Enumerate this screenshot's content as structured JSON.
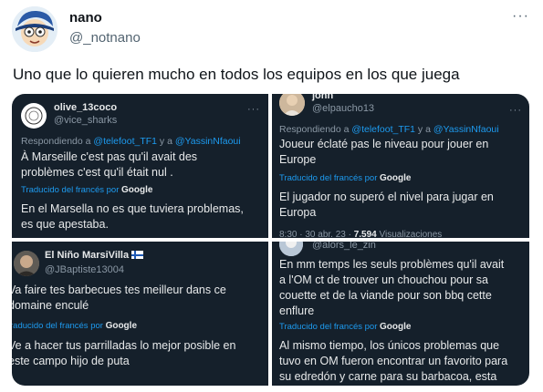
{
  "author": {
    "name": "nano",
    "handle": "@_notnano",
    "more_icon": "more-dots-icon"
  },
  "tweet": {
    "text": "Uno que lo quieren mucho en todos los equipos en los que juega"
  },
  "panels": [
    {
      "name": "olive_13coco",
      "handle": "@vice_sharks",
      "reply_prefix": "Respondiendo a ",
      "mention1": "@telefoot_TF1",
      "reply_and": " y a ",
      "mention2": "@YassinNfaoui",
      "original_lines": [
        "À  Marseille c'est pas qu'il avait des",
        "problèmes c'est qu'il était nul ."
      ],
      "translated_by": "Traducido del francés por ",
      "google": "Google",
      "translation_lines": [
        "En el Marsella no es que tuviera problemas,",
        "es que apestaba."
      ]
    },
    {
      "name": "john",
      "handle": "@elpaucho13",
      "reply_prefix": "Respondiendo a ",
      "mention1": "@telefoot_TF1",
      "reply_and": " y a ",
      "mention2": "@YassinNfaoui",
      "original_lines": [
        "Joueur éclaté pas le niveau pour jouer en",
        "Europe"
      ],
      "translated_by": "Traducido del francés por ",
      "google": "Google",
      "translation_lines": [
        "El jugador no superó el nivel para jugar en",
        "Europa"
      ],
      "meta_time": "8:30 · 30 abr. 23 · ",
      "meta_views": "7.594",
      "meta_views_label": " Visualizaciones"
    },
    {
      "name": "El Niño MarsiVilla",
      "handle": "@JBaptiste13004",
      "original_lines": [
        "Va faire tes barbecues tes meilleur dans ce",
        "domaine enculé"
      ],
      "translated_by": "raducido del francés por ",
      "google": "Google",
      "translation_lines": [
        "Ve a hacer tus parrilladas lo mejor posible en",
        "este campo hijo de puta"
      ]
    },
    {
      "handle": "@alors_le_zin",
      "original_lines": [
        "En mm temps les seuls problèmes qu'il avait",
        "a l'OM ct de trouver un chouchou pour sa",
        "couette et de la viande pour son bbq cette",
        "enflure"
      ],
      "translated_by": "Traducido del francés por ",
      "google": "Google",
      "translation_lines": [
        "Al mismo tiempo, los únicos problemas que",
        "tuvo en OM fueron encontrar un favorito para",
        "su edredón y carne para su barbacoa, esta"
      ]
    }
  ],
  "colors": {
    "panel_bg": "#15202b",
    "link": "#1d9bf0",
    "muted": "#8b98a5",
    "text_dark": "#e7e9ea"
  }
}
